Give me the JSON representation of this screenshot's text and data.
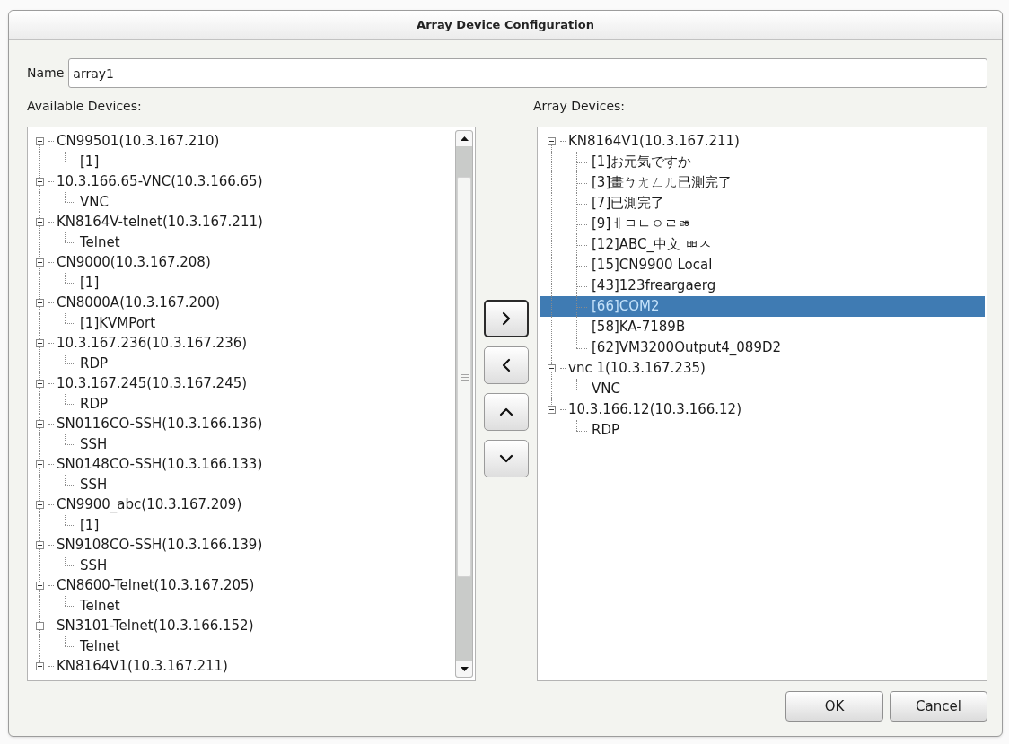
{
  "window": {
    "title": "Array Device Configuration"
  },
  "name_field": {
    "label": "Name",
    "value": "array1"
  },
  "available_devices": {
    "label": "Available Devices:",
    "items": [
      {
        "label": "CN99501(10.3.167.210)",
        "expanded": true,
        "selected": false,
        "children": [
          {
            "label": "[1]",
            "selected": false
          }
        ]
      },
      {
        "label": "10.3.166.65-VNC(10.3.166.65)",
        "expanded": true,
        "selected": false,
        "children": [
          {
            "label": "VNC",
            "selected": false
          }
        ]
      },
      {
        "label": "KN8164V-telnet(10.3.167.211)",
        "expanded": true,
        "selected": false,
        "children": [
          {
            "label": "Telnet",
            "selected": false
          }
        ]
      },
      {
        "label": "CN9000(10.3.167.208)",
        "expanded": true,
        "selected": false,
        "children": [
          {
            "label": "[1]",
            "selected": false
          }
        ]
      },
      {
        "label": "CN8000A(10.3.167.200)",
        "expanded": true,
        "selected": false,
        "children": [
          {
            "label": "[1]KVMPort",
            "selected": false
          }
        ]
      },
      {
        "label": "10.3.167.236(10.3.167.236)",
        "expanded": true,
        "selected": false,
        "children": [
          {
            "label": "RDP",
            "selected": false
          }
        ]
      },
      {
        "label": "10.3.167.245(10.3.167.245)",
        "expanded": true,
        "selected": false,
        "children": [
          {
            "label": "RDP",
            "selected": false
          }
        ]
      },
      {
        "label": "SN0116CO-SSH(10.3.166.136)",
        "expanded": true,
        "selected": false,
        "children": [
          {
            "label": "SSH",
            "selected": false
          }
        ]
      },
      {
        "label": "SN0148CO-SSH(10.3.166.133)",
        "expanded": true,
        "selected": false,
        "children": [
          {
            "label": "SSH",
            "selected": false
          }
        ]
      },
      {
        "label": "CN9900_abc(10.3.167.209)",
        "expanded": true,
        "selected": false,
        "children": [
          {
            "label": "[1]",
            "selected": false
          }
        ]
      },
      {
        "label": "SN9108CO-SSH(10.3.166.139)",
        "expanded": true,
        "selected": false,
        "children": [
          {
            "label": "SSH",
            "selected": false
          }
        ]
      },
      {
        "label": "CN8600-Telnet(10.3.167.205)",
        "expanded": true,
        "selected": false,
        "children": [
          {
            "label": "Telnet",
            "selected": false
          }
        ]
      },
      {
        "label": "SN3101-Telnet(10.3.166.152)",
        "expanded": true,
        "selected": false,
        "children": [
          {
            "label": "Telnet",
            "selected": false
          }
        ]
      },
      {
        "label": "KN8164V1(10.3.167.211)",
        "expanded": true,
        "selected": false
      }
    ]
  },
  "move_buttons": [
    {
      "kind": "add",
      "focused": true
    },
    {
      "kind": "remove",
      "focused": false
    },
    {
      "kind": "move_up",
      "focused": false
    },
    {
      "kind": "move_down",
      "focused": false
    }
  ],
  "array_devices": {
    "label": "Array Devices:",
    "items": [
      {
        "label": "KN8164V1(10.3.167.211)",
        "expanded": true,
        "selected": false,
        "children": [
          {
            "label": "[1]お元気ですか",
            "selected": false
          },
          {
            "label": "[3]畫ㄅㄤㄥㄦ已測完了",
            "selected": false
          },
          {
            "label": "[7]已測完了",
            "selected": false
          },
          {
            "label": "[9]ㅔㅁㄴㅇㄹㅀ",
            "selected": false
          },
          {
            "label": "[12]ABC_中文 ㅃㅈ",
            "selected": false
          },
          {
            "label": "[15]CN9900 Local",
            "selected": false
          },
          {
            "label": "[43]123freargaerg",
            "selected": false
          },
          {
            "label": "[66]COM2",
            "selected": true
          },
          {
            "label": "[58]KA-7189B",
            "selected": false
          },
          {
            "label": "[62]VM3200Output4_089D2",
            "selected": false
          }
        ]
      },
      {
        "label": "vnc 1(10.3.167.235)",
        "expanded": true,
        "selected": false,
        "children": [
          {
            "label": "VNC",
            "selected": false
          }
        ]
      },
      {
        "label": "10.3.166.12(10.3.166.12)",
        "expanded": true,
        "selected": false,
        "children": [
          {
            "label": "RDP",
            "selected": false
          }
        ]
      }
    ]
  },
  "buttons": [
    {
      "label": "OK"
    },
    {
      "label": "Cancel"
    }
  ]
}
